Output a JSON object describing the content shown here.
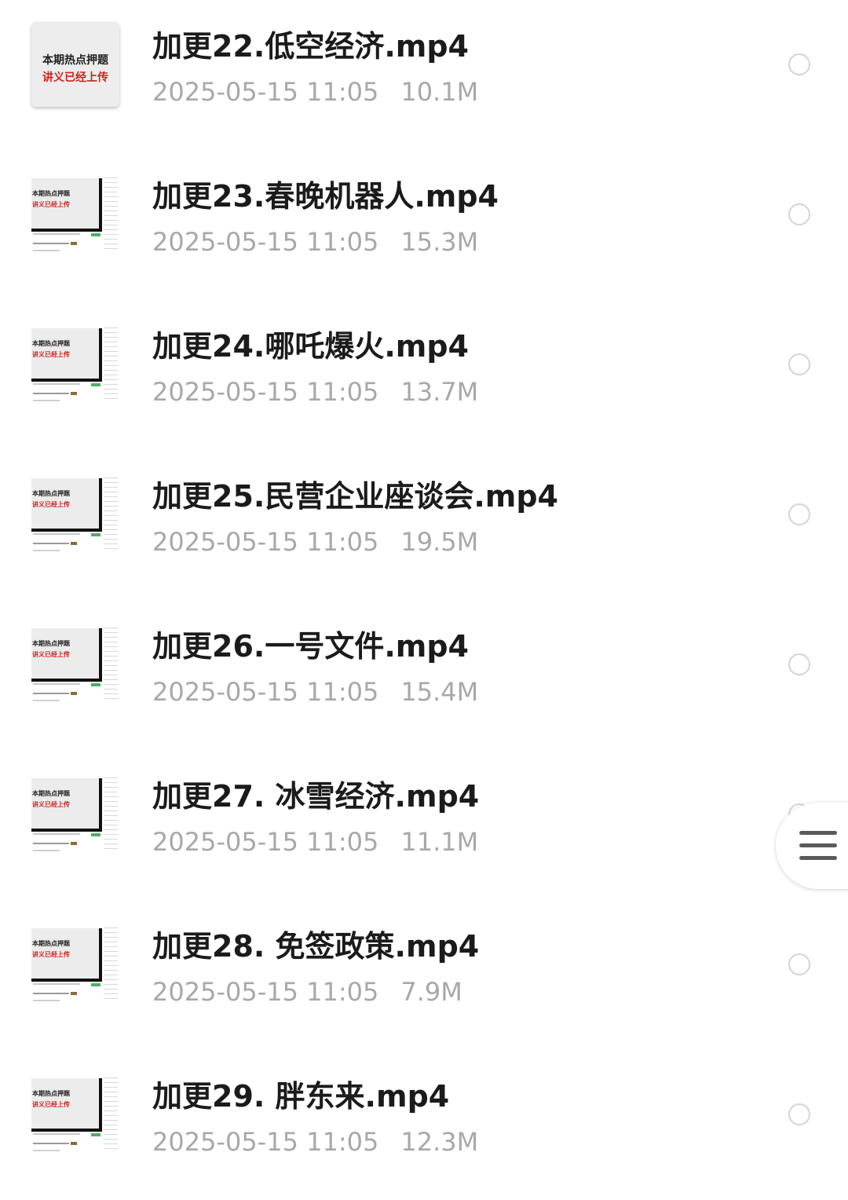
{
  "thumbnail": {
    "line1": "本期热点押题",
    "line2": "讲义已经上传",
    "accent_red": "#d21f1f"
  },
  "files": [
    {
      "name": "加更22.低空经济.mp4",
      "date": "2025-05-15 11:05",
      "size": "10.1M"
    },
    {
      "name": "加更23.春晚机器人.mp4",
      "date": "2025-05-15 11:05",
      "size": "15.3M"
    },
    {
      "name": "加更24.哪吒爆火.mp4",
      "date": "2025-05-15 11:05",
      "size": "13.7M"
    },
    {
      "name": "加更25.民营企业座谈会.mp4",
      "date": "2025-05-15 11:05",
      "size": "19.5M"
    },
    {
      "name": "加更26.一号文件.mp4",
      "date": "2025-05-15 11:05",
      "size": "15.4M"
    },
    {
      "name": "加更27. 冰雪经济.mp4",
      "date": "2025-05-15 11:05",
      "size": "11.1M"
    },
    {
      "name": "加更28. 免签政策.mp4",
      "date": "2025-05-15 11:05",
      "size": "7.9M"
    },
    {
      "name": "加更29. 胖东来.mp4",
      "date": "2025-05-15 11:05",
      "size": "12.3M"
    }
  ],
  "float_menu": {
    "icon": "menu-icon"
  }
}
